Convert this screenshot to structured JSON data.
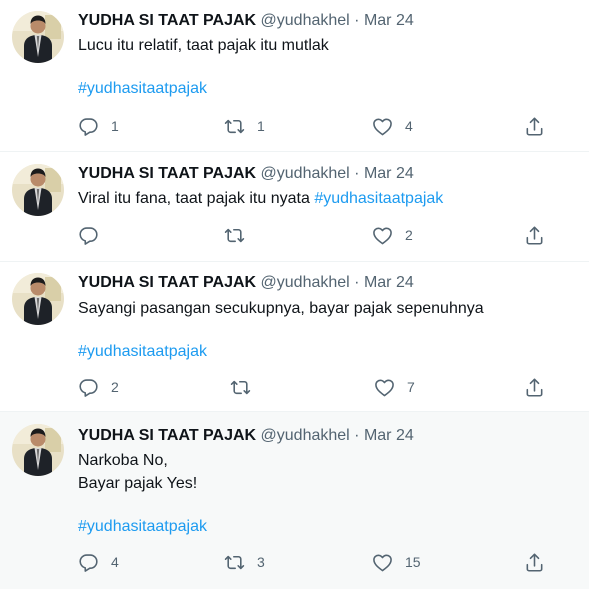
{
  "tweets": [
    {
      "name": "YUDHA SI TAAT PAJAK",
      "handle": "@yudhakhel",
      "sep": "·",
      "date": "Mar 24",
      "text_lines": [
        "Lucu itu relatif, taat pajak itu mutlak"
      ],
      "inline_hashtag": "",
      "hashtag": "#yudhasitaatpajak",
      "replies": "1",
      "retweets": "1",
      "likes": "4"
    },
    {
      "name": "YUDHA SI TAAT PAJAK",
      "handle": "@yudhakhel",
      "sep": "·",
      "date": "Mar 24",
      "text_lines": [
        "Viral itu fana, taat pajak itu nyata"
      ],
      "inline_hashtag": "#yudhasitaatpajak",
      "hashtag": "",
      "replies": "",
      "retweets": "",
      "likes": "2"
    },
    {
      "name": "YUDHA SI TAAT PAJAK",
      "handle": "@yudhakhel",
      "sep": "·",
      "date": "Mar 24",
      "text_lines": [
        "Sayangi pasangan secukupnya, bayar pajak sepenuhnya"
      ],
      "inline_hashtag": "",
      "hashtag": "#yudhasitaatpajak",
      "replies": "2",
      "retweets": "",
      "likes": "7"
    },
    {
      "name": "YUDHA SI TAAT PAJAK",
      "handle": "@yudhakhel",
      "sep": "·",
      "date": "Mar 24",
      "text_lines": [
        "Narkoba No,",
        "Bayar pajak Yes!"
      ],
      "inline_hashtag": "",
      "hashtag": "#yudhasitaatpajak",
      "replies": "4",
      "retweets": "3",
      "likes": "15"
    }
  ],
  "icons": {
    "reply": "reply-icon",
    "retweet": "retweet-icon",
    "like": "heart-icon",
    "share": "share-icon",
    "avatar": "profile-photo"
  },
  "colors": {
    "text": "#0f1419",
    "muted": "#536471",
    "link": "#1d9bf0",
    "highlight_bg": "#f7f9f9",
    "divider": "#eff3f4"
  }
}
